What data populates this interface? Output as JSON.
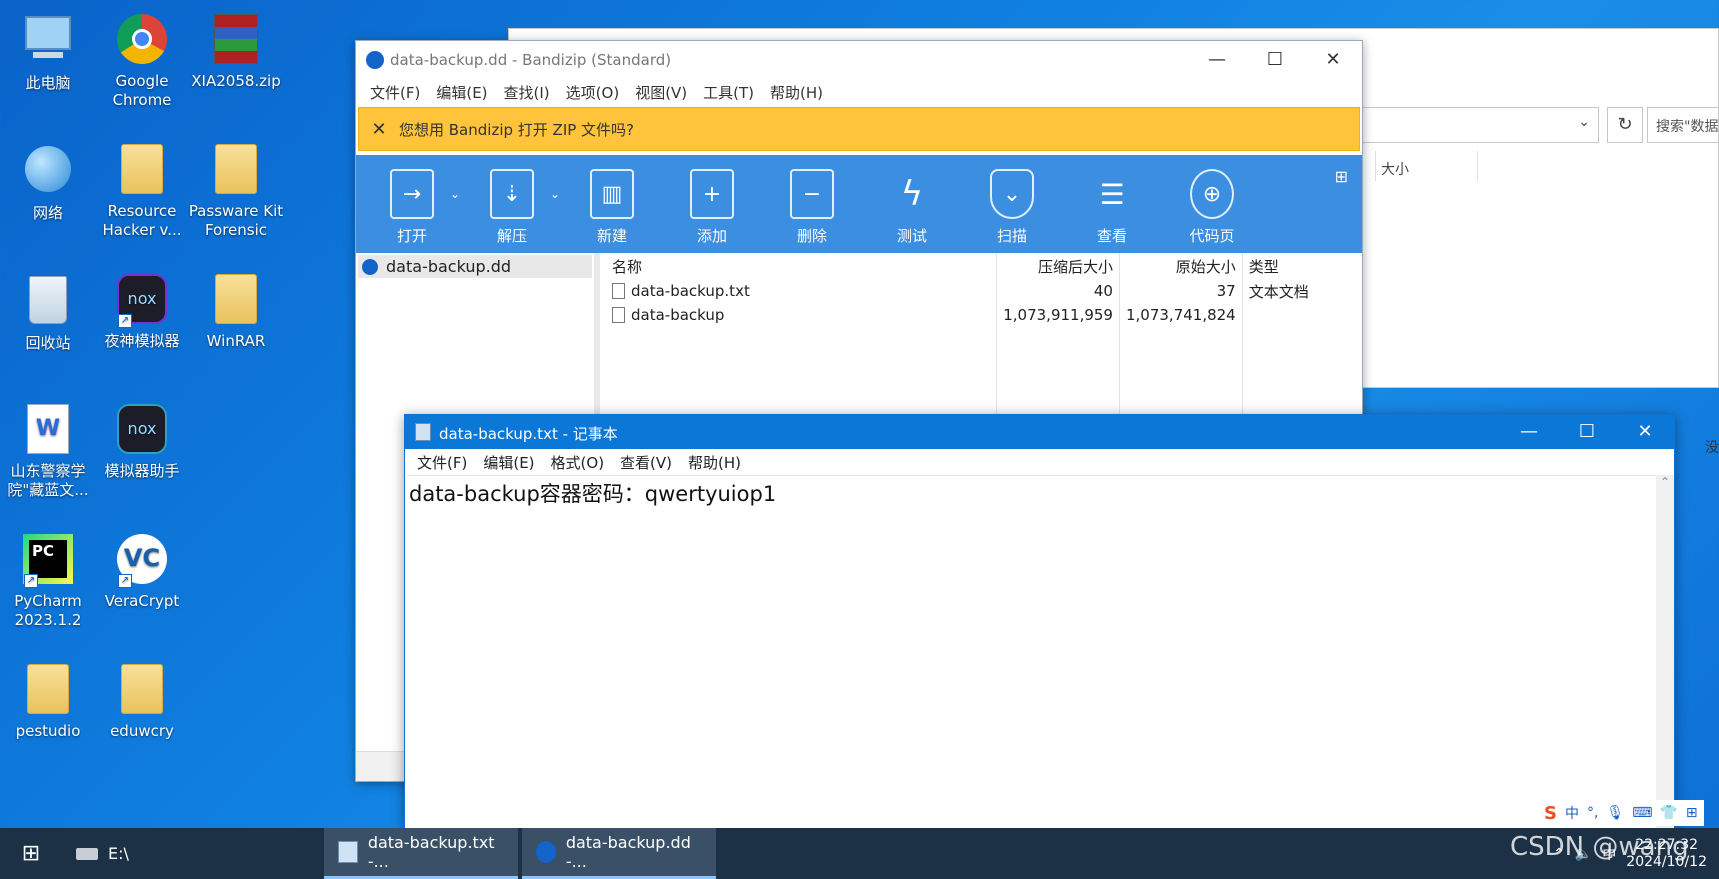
{
  "desktop": {
    "icons": [
      {
        "label": "此电脑"
      },
      {
        "label": "Google Chrome"
      },
      {
        "label": "XIA2058.zip"
      },
      {
        "label": "网络"
      },
      {
        "label": "Resource Hacker v..."
      },
      {
        "label": "Passware Kit Forensic"
      },
      {
        "label": "回收站"
      },
      {
        "label": "夜神模拟器"
      },
      {
        "label": "WinRAR"
      },
      {
        "label": "山东警察学院\"藏蓝文..."
      },
      {
        "label": "模拟器助手"
      },
      {
        "label": "PyCharm 2023.1.2"
      },
      {
        "label": "VeraCrypt"
      },
      {
        "label": "pestudio"
      },
      {
        "label": "eduwcry"
      }
    ]
  },
  "explorer": {
    "search_placeholder": "搜索\"数据",
    "col_size": "大小",
    "side_text": "没"
  },
  "bandizip": {
    "title": "data-backup.dd - Bandizip (Standard)",
    "menu": [
      "文件(F)",
      "编辑(E)",
      "查找(I)",
      "选项(O)",
      "视图(V)",
      "工具(T)",
      "帮助(H)"
    ],
    "banner": "您想用 Bandizip 打开 ZIP 文件吗?",
    "toolbar": [
      "打开",
      "解压",
      "新建",
      "添加",
      "删除",
      "测试",
      "扫描",
      "查看",
      "代码页"
    ],
    "tree_root": "data-backup.dd",
    "columns": {
      "name": "名称",
      "compressed": "压缩后大小",
      "original": "原始大小",
      "type": "类型"
    },
    "files": [
      {
        "name": "data-backup.txt",
        "compressed": "40",
        "original": "37",
        "type": "文本文档"
      },
      {
        "name": "data-backup",
        "compressed": "1,073,911,959",
        "original": "1,073,741,824",
        "type": ""
      }
    ]
  },
  "notepad": {
    "title": "data-backup.txt - 记事本",
    "menu": [
      "文件(F)",
      "编辑(E)",
      "格式(O)",
      "查看(V)",
      "帮助(H)"
    ],
    "content": "data-backup容器密码：qwertyuiop1"
  },
  "taskbar": {
    "items": [
      {
        "label": "E:\\"
      },
      {
        "label": "data-backup.txt -..."
      },
      {
        "label": "data-backup.dd -..."
      }
    ],
    "time": "22:27:32",
    "date": "2024/10/12",
    "ime_lang": "中"
  },
  "watermark": "CSDN @wang"
}
